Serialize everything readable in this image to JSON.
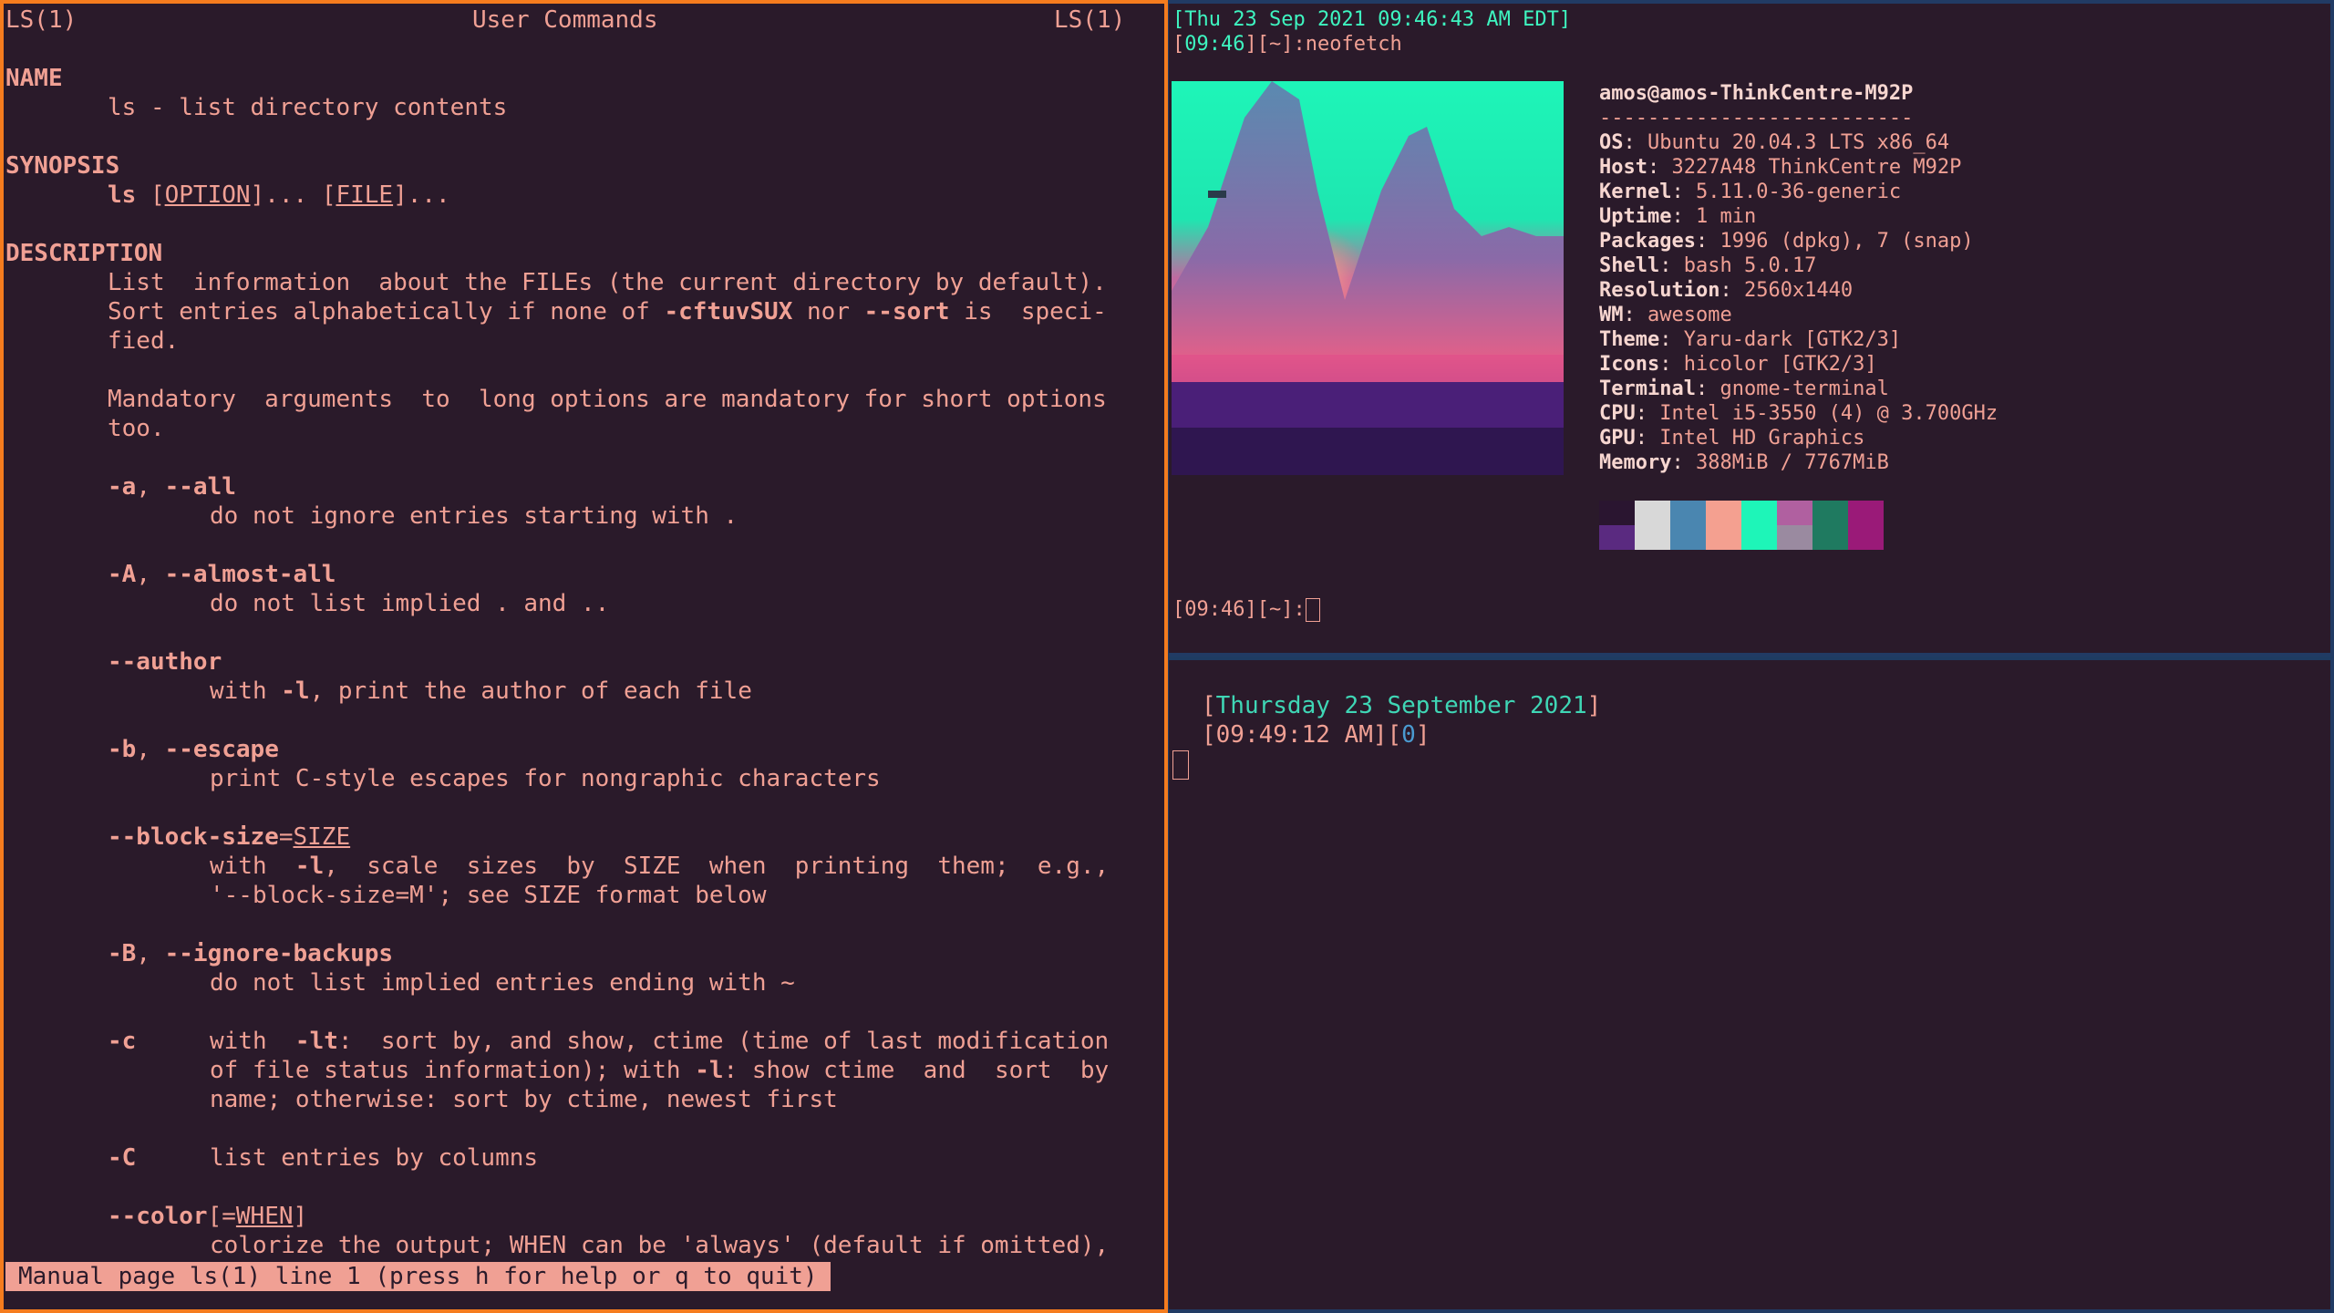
{
  "man": {
    "header_left": "LS(1)",
    "header_center": "User Commands",
    "header_right": "LS(1)",
    "name_heading": "NAME",
    "name_desc": "ls - list directory contents",
    "synopsis_heading": "SYNOPSIS",
    "synopsis_cmd": "ls",
    "synopsis_opt": "OPTION",
    "synopsis_file": "FILE",
    "description_heading": "DESCRIPTION",
    "desc_line1": "List  information  about the FILEs (the current directory by default).",
    "desc_line2a": "Sort entries alphabetically if none of ",
    "desc_line2b": "-cftuvSUX",
    "desc_line2c": " nor ",
    "desc_line2d": "--sort",
    "desc_line2e": " is  speci-",
    "desc_line3": "fied.",
    "mandatory1": "Mandatory  arguments  to  long options are mandatory for short options",
    "mandatory2": "too.",
    "opt_a": "-a",
    "opt_all": "--all",
    "opt_a_desc": "do not ignore entries starting with .",
    "opt_A": "-A",
    "opt_almost_all": "--almost-all",
    "opt_A_desc": "do not list implied . and ..",
    "opt_author": "--author",
    "opt_author_desc_a": "with ",
    "opt_author_desc_b": "-l",
    "opt_author_desc_c": ", print the author of each file",
    "opt_b": "-b",
    "opt_escape": "--escape",
    "opt_b_desc": "print C-style escapes for nongraphic characters",
    "opt_block_size": "--block-size",
    "opt_block_size_arg": "SIZE",
    "opt_block_desc1a": "with  ",
    "opt_block_desc1b": "-l",
    "opt_block_desc1c": ",  scale  sizes  by  SIZE  when  printing  them;  e.g.,",
    "opt_block_desc2": "'--block-size=M'; see SIZE format below",
    "opt_B": "-B",
    "opt_ignore_backups": "--ignore-backups",
    "opt_B_desc": "do not list implied entries ending with ~",
    "opt_c": "-c",
    "opt_c_desc1a": "with  ",
    "opt_c_desc1b": "-lt",
    "opt_c_desc1c": ":  sort by, and show, ctime (time of last modification",
    "opt_c_desc2a": "of file status information); with ",
    "opt_c_desc2b": "-l",
    "opt_c_desc2c": ": show ctime  and  sort  by",
    "opt_c_desc3": "name; otherwise: sort by ctime, newest first",
    "opt_C": "-C",
    "opt_C_desc": "list entries by columns",
    "opt_color": "--color",
    "opt_color_arg": "WHEN",
    "opt_color_desc": "colorize the output; WHEN can be 'always' (default if omitted),",
    "status": "Manual page ls(1) line 1 (press h for help or q to quit)"
  },
  "neofetch": {
    "date_line": "[Thu 23 Sep 2021 09:46:43 AM EDT]",
    "prompt_time": "09:46",
    "prompt_dir": "~",
    "command": "neofetch",
    "user": "amos",
    "host": "amos-ThinkCentre-M92P",
    "separator": "--------------------------",
    "info": [
      {
        "label": "OS",
        "value": "Ubuntu 20.04.3 LTS x86_64"
      },
      {
        "label": "Host",
        "value": "3227A48 ThinkCentre M92P"
      },
      {
        "label": "Kernel",
        "value": "5.11.0-36-generic"
      },
      {
        "label": "Uptime",
        "value": "1 min"
      },
      {
        "label": "Packages",
        "value": "1996 (dpkg), 7 (snap)"
      },
      {
        "label": "Shell",
        "value": "bash 5.0.17"
      },
      {
        "label": "Resolution",
        "value": "2560x1440"
      },
      {
        "label": "WM",
        "value": "awesome"
      },
      {
        "label": "Theme",
        "value": "Yaru-dark [GTK2/3]"
      },
      {
        "label": "Icons",
        "value": "hicolor [GTK2/3]"
      },
      {
        "label": "Terminal",
        "value": "gnome-terminal"
      },
      {
        "label": "CPU",
        "value": "Intel i5-3550 (4) @ 3.700GHz"
      },
      {
        "label": "GPU",
        "value": "Intel HD Graphics"
      },
      {
        "label": "Memory",
        "value": "388MiB / 7767MiB"
      }
    ],
    "palette_top": [
      "#2a1530",
      "#d8d8d8",
      "#4a86b0",
      "#f4a090",
      "#1ef5b8",
      "#b060a0",
      "#1f7a60",
      "#9a1a78"
    ],
    "palette_bottom": [
      "#5a2a80",
      "#d8d8d8",
      "#4a86b0",
      "#f4a090",
      "#1ef5b8",
      "#9a8aa0",
      "#1f7a60",
      "#9a1a78"
    ],
    "prompt2_time": "09:46",
    "prompt2_dir": "~"
  },
  "calendar": {
    "date": "Thursday 23 September 2021",
    "time": "09:49:12 AM",
    "count": "0"
  }
}
